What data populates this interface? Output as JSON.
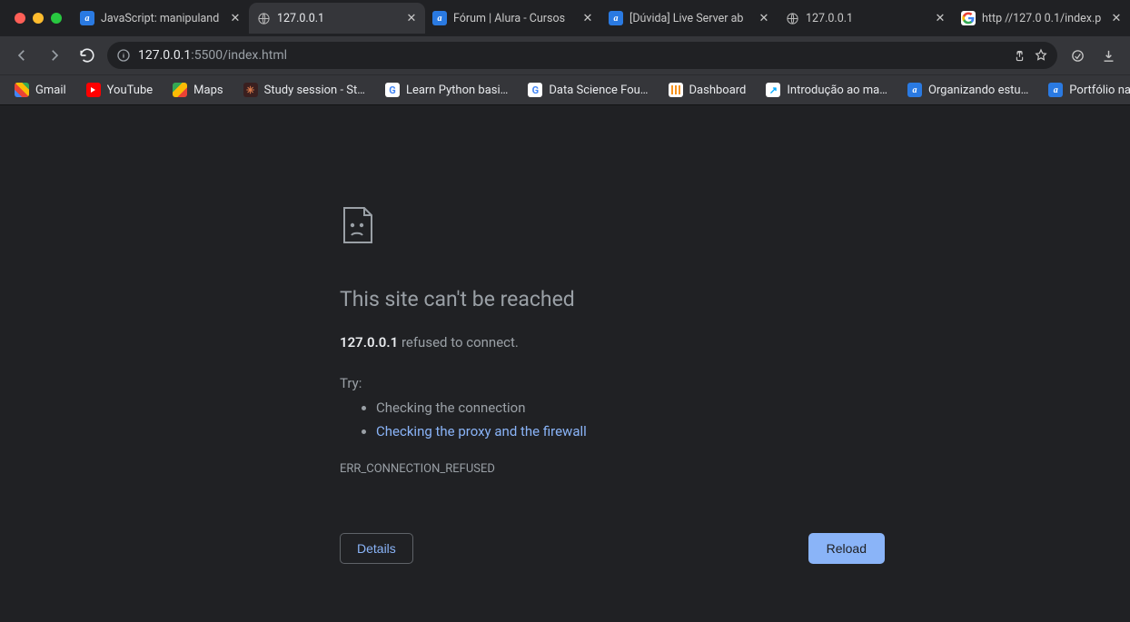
{
  "window": {
    "traffic": [
      "red",
      "yellow",
      "green"
    ]
  },
  "tabs": [
    {
      "title": "JavaScript: manipuland",
      "favicon": "alura"
    },
    {
      "title": "127.0.0.1",
      "favicon": "globe",
      "active": true
    },
    {
      "title": "Fórum | Alura - Cursos",
      "favicon": "alura"
    },
    {
      "title": "[Dúvida] Live Server ab",
      "favicon": "alura"
    },
    {
      "title": "127.0.0.1",
      "favicon": "globe"
    },
    {
      "title": "http //127.0 0.1/index.p",
      "favicon": "google"
    }
  ],
  "toolbar": {
    "url_host": "127.0.0.1",
    "url_rest": ":5500/index.html"
  },
  "bookmarks": [
    {
      "label": "Gmail",
      "icon": "gmail"
    },
    {
      "label": "YouTube",
      "icon": "yt"
    },
    {
      "label": "Maps",
      "icon": "maps"
    },
    {
      "label": "Study session - St…",
      "icon": "study"
    },
    {
      "label": "Learn Python basi…",
      "icon": "g"
    },
    {
      "label": "Data Science Fou…",
      "icon": "g"
    },
    {
      "label": "Dashboard",
      "icon": "dash"
    },
    {
      "label": "Introdução ao ma…",
      "icon": "cursor"
    },
    {
      "label": "Organizando estu…",
      "icon": "alura"
    },
    {
      "label": "Portfólio na área d…",
      "icon": "alura"
    }
  ],
  "error": {
    "title": "This site can't be reached",
    "host_bold": "127.0.0.1",
    "refused_text": " refused to connect.",
    "try_label": "Try:",
    "suggestions": [
      {
        "text": "Checking the connection",
        "link": false
      },
      {
        "text": "Checking the proxy and the firewall",
        "link": true
      }
    ],
    "code": "ERR_CONNECTION_REFUSED",
    "details_btn": "Details",
    "reload_btn": "Reload"
  }
}
